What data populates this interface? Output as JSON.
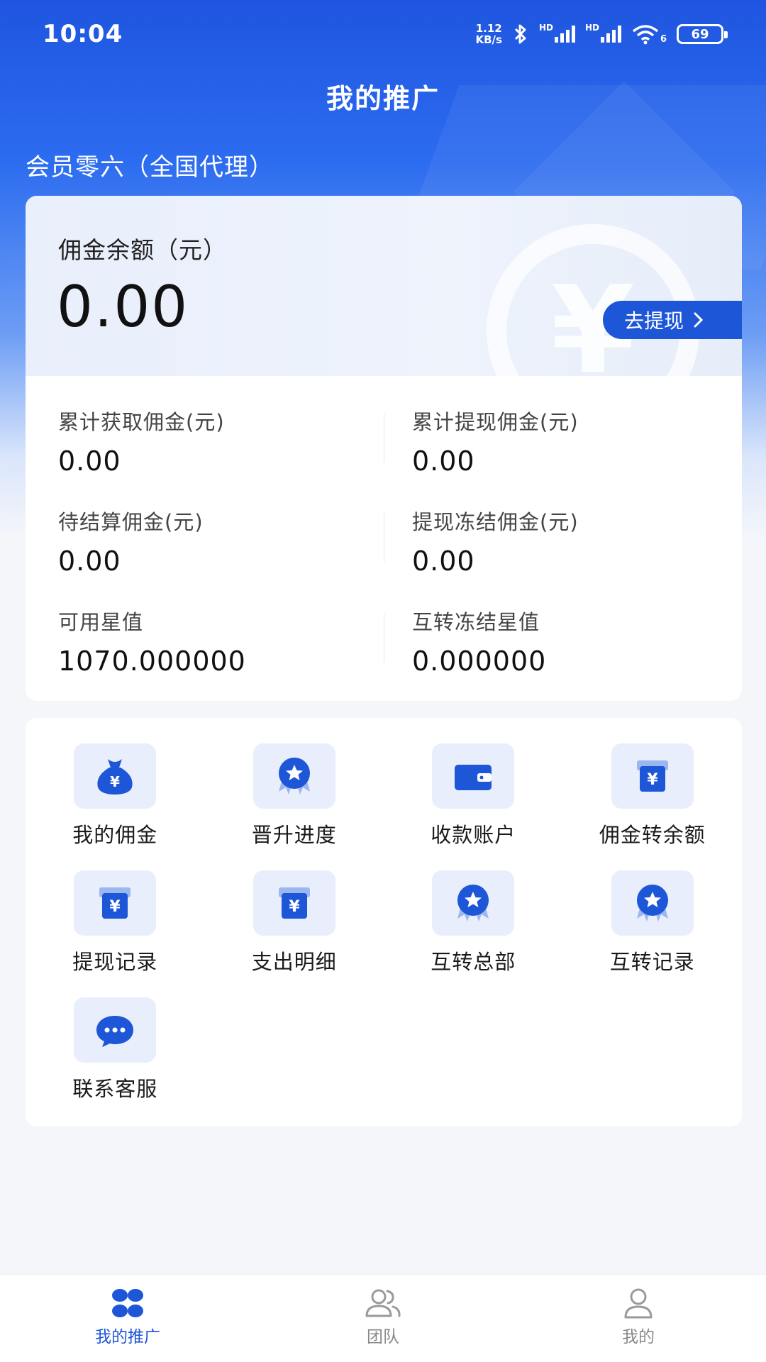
{
  "status_bar": {
    "time": "10:04",
    "net_speed_value": "1.12",
    "net_speed_unit": "KB/s",
    "signal_label": "HD",
    "wifi_label": "6",
    "battery": "69"
  },
  "header": {
    "title": "我的推广",
    "member": "会员零六（全国代理）"
  },
  "balance": {
    "label": "佣金余额（元）",
    "value": "0.00",
    "withdraw_label": "去提现",
    "coin_symbol": "¥"
  },
  "stats": [
    [
      {
        "label": "累计获取佣金(元)",
        "value": "0.00"
      },
      {
        "label": "累计提现佣金(元)",
        "value": "0.00"
      }
    ],
    [
      {
        "label": "待结算佣金(元)",
        "value": "0.00"
      },
      {
        "label": "提现冻结佣金(元)",
        "value": "0.00"
      }
    ],
    [
      {
        "label": "可用星值",
        "value": "1070.000000"
      },
      {
        "label": "互转冻结星值",
        "value": "0.000000"
      }
    ]
  ],
  "menu": [
    {
      "label": "我的佣金",
      "icon": "money-bag-icon"
    },
    {
      "label": "晋升进度",
      "icon": "star-badge-icon"
    },
    {
      "label": "收款账户",
      "icon": "wallet-icon"
    },
    {
      "label": "佣金转余额",
      "icon": "yuan-card-icon"
    },
    {
      "label": "提现记录",
      "icon": "yuan-card-icon"
    },
    {
      "label": "支出明细",
      "icon": "yuan-card-icon"
    },
    {
      "label": "互转总部",
      "icon": "star-badge-icon"
    },
    {
      "label": "互转记录",
      "icon": "star-badge-icon"
    },
    {
      "label": "联系客服",
      "icon": "chat-bubble-icon"
    }
  ],
  "tabbar": [
    {
      "label": "我的推广",
      "icon": "grid-clover-icon",
      "active": true
    },
    {
      "label": "团队",
      "icon": "team-icon",
      "active": false
    },
    {
      "label": "我的",
      "icon": "profile-icon",
      "active": false
    }
  ],
  "colors": {
    "primary": "#1e56d8",
    "icon_bg": "#e8eefb",
    "inactive": "#888888"
  }
}
